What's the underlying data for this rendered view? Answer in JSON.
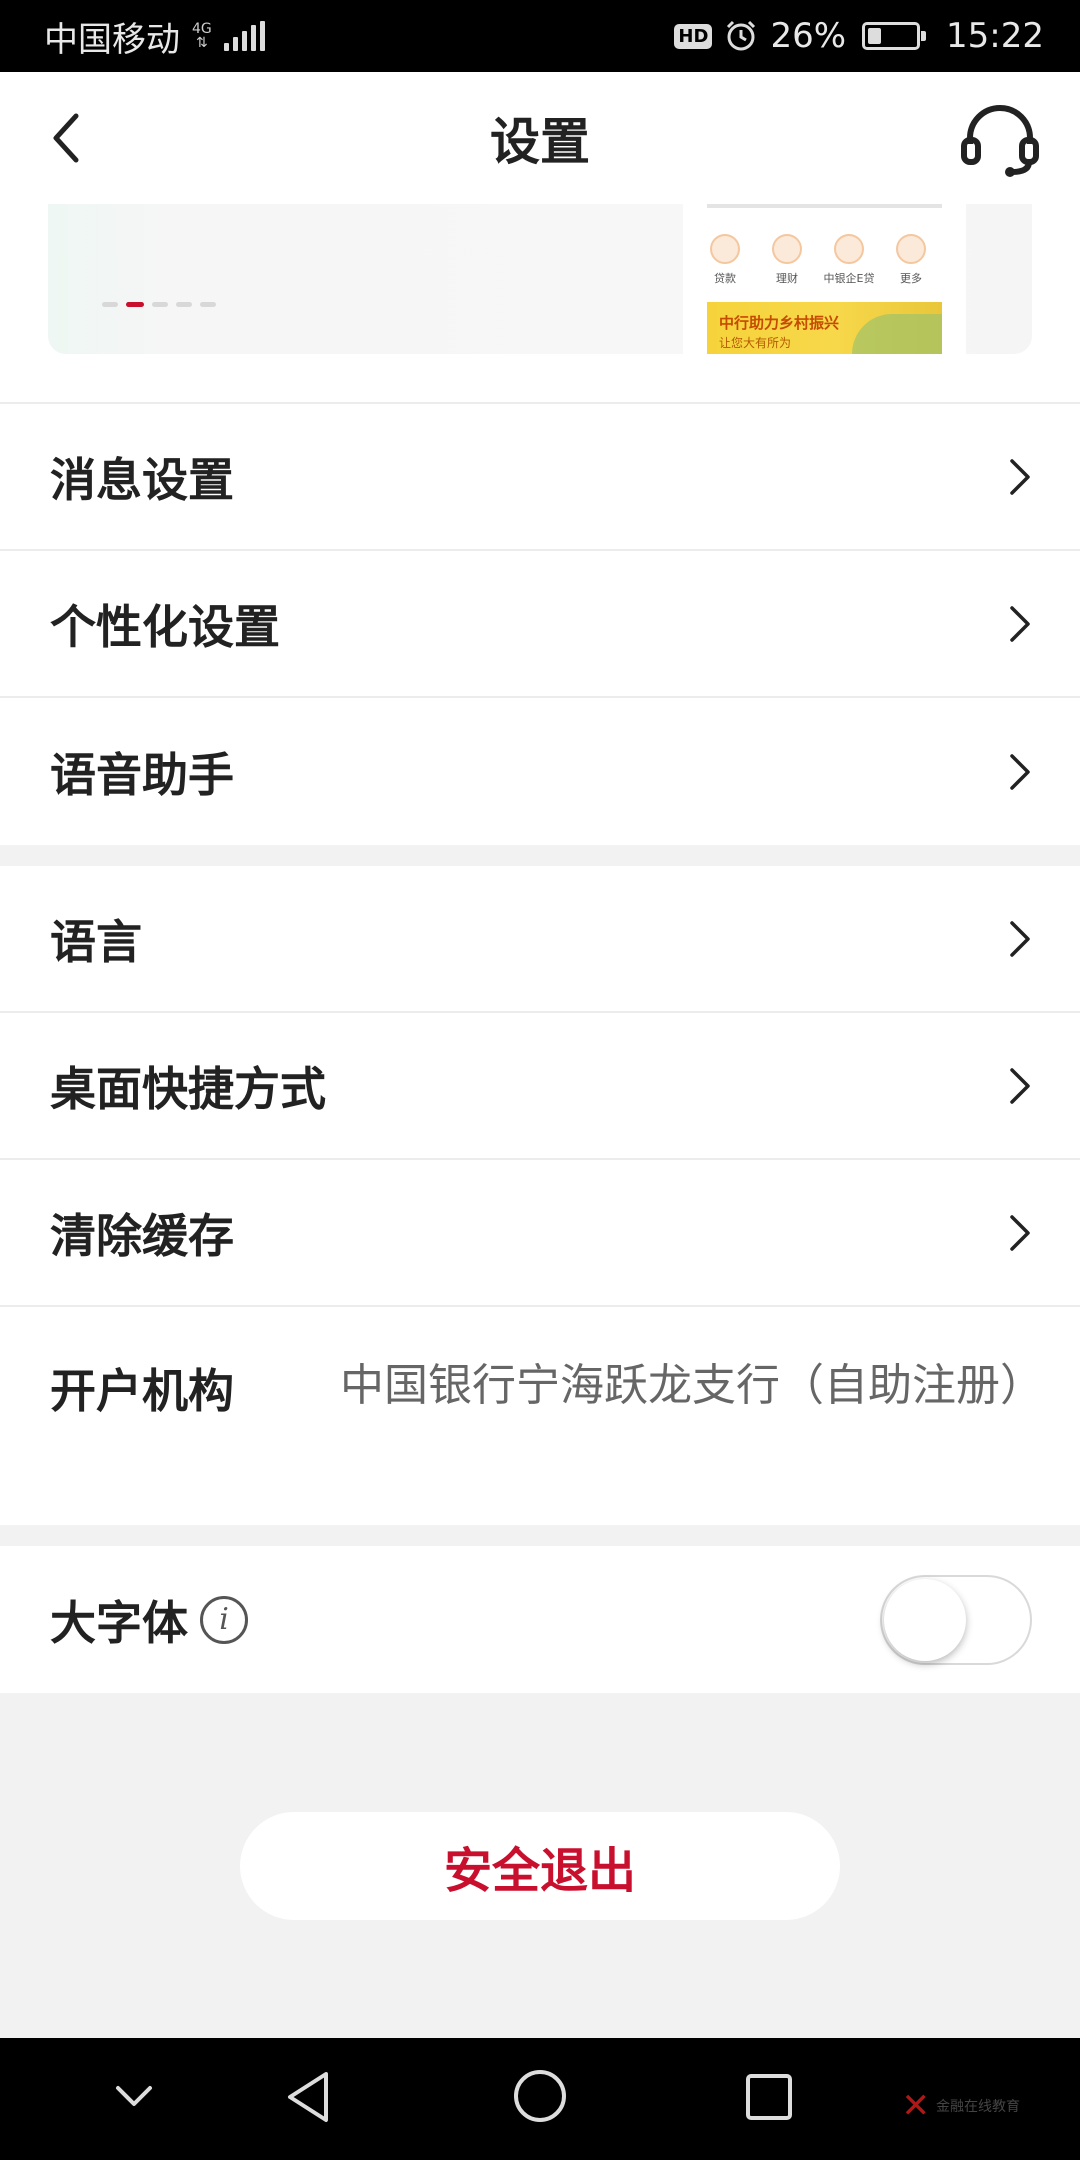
{
  "status_bar": {
    "carrier": "中国移动",
    "network": "4G",
    "battery": "26%",
    "time": "15:22",
    "hd": "HD"
  },
  "header": {
    "title": "设置"
  },
  "banner": {
    "quick_icons": [
      "贷款",
      "理财",
      "中银企E贷",
      "更多"
    ],
    "promo_title": "中行助力乡村振兴",
    "promo_sub": "让您大有所为",
    "active_dot": 1,
    "dot_count": 5
  },
  "group1": [
    {
      "label": "消息设置"
    },
    {
      "label": "个性化设置"
    },
    {
      "label": "语音助手"
    }
  ],
  "group2": [
    {
      "label": "语言"
    },
    {
      "label": "桌面快捷方式"
    },
    {
      "label": "清除缓存"
    }
  ],
  "org": {
    "label": "开户机构",
    "value": "中国银行宁海跃龙支行（自助注册）"
  },
  "large_font": {
    "label": "大字体",
    "info": "i",
    "enabled": false
  },
  "logout": {
    "label": "安全退出"
  },
  "watermark": {
    "text": "金融在线教育"
  },
  "colors": {
    "accent": "#c8102e",
    "background": "#f2f2f2"
  }
}
